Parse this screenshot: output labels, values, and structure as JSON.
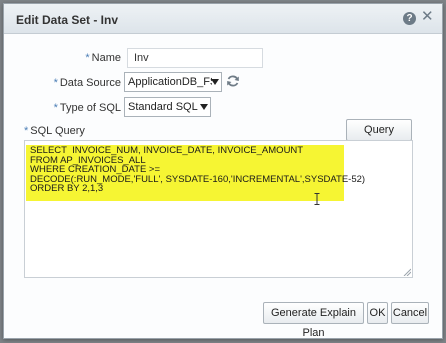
{
  "dialog": {
    "title": "Edit Data Set - Inv",
    "help_icon": "help-icon",
    "close_icon": "close-icon"
  },
  "form": {
    "required_marker": "*",
    "name_label": "Name",
    "name_value": "Inv",
    "data_source_label": "Data Source",
    "data_source_value": "ApplicationDB_FSCM",
    "type_of_sql_label": "Type of SQL",
    "type_of_sql_value": "Standard SQL",
    "sql_query_label": "SQL Query",
    "query_builder_label": "Query Builder",
    "sql_lines": [
      "SELECT  INVOICE_NUM, INVOICE_DATE, INVOICE_AMOUNT",
      "FROM AP_INVOICES_ALL",
      "WHERE CREATION_DATE >=",
      "DECODE(:RUN_MODE,'FULL', SYSDATE-160,'INCREMENTAL',SYSDATE-52)",
      "ORDER BY 2,1,3"
    ]
  },
  "footer": {
    "explain_plan_label": "Generate Explain Plan",
    "ok_label": "OK",
    "cancel_label": "Cancel"
  },
  "colors": {
    "highlight": "#f6f533",
    "required_marker": "#4a7db5"
  }
}
